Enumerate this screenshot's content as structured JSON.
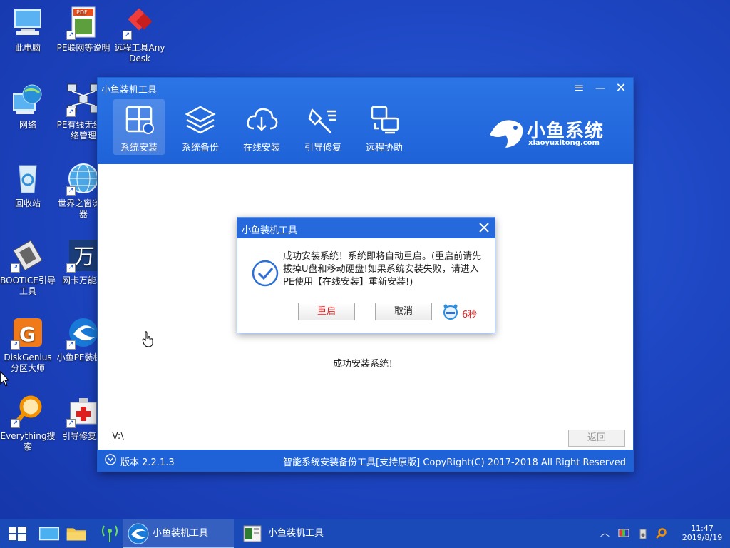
{
  "desktop": {
    "icons": [
      {
        "label": "此电脑"
      },
      {
        "label": "PE联网等说明"
      },
      {
        "label": "远程工具AnyDesk"
      },
      {
        "label": "网络"
      },
      {
        "label": "PE有线无线网络管理"
      },
      {
        "label": "回收站"
      },
      {
        "label": "世界之窗浏览器"
      },
      {
        "label": "BOOTICE引导工具"
      },
      {
        "label": "网卡万能驱"
      },
      {
        "label": "DiskGenius分区大师"
      },
      {
        "label": "小鱼PE装机具"
      },
      {
        "label": "Everything搜索"
      },
      {
        "label": "引导修复工"
      }
    ]
  },
  "window": {
    "title": "小鱼装机工具",
    "controls": {
      "menu": "≡",
      "minimize": "—",
      "close": "✕"
    },
    "toolbar": [
      {
        "label": "系统安装",
        "icon": "windows-install-icon",
        "active": true
      },
      {
        "label": "系统备份",
        "icon": "layers-backup-icon",
        "active": false
      },
      {
        "label": "在线安装",
        "icon": "cloud-download-icon",
        "active": false
      },
      {
        "label": "引导修复",
        "icon": "tools-repair-icon",
        "active": false
      },
      {
        "label": "远程协助",
        "icon": "remote-assist-icon",
        "active": false
      }
    ],
    "brand": {
      "name": "小鱼系统",
      "url": "xiaoyuxitong.com"
    },
    "status_message": "成功安装系统！",
    "path": "V:\\",
    "back_button": "返回",
    "footer": {
      "version": "版本 2.2.1.3",
      "copyright": "智能系统安装备份工具[支持原版]  CopyRight(C) 2017-2018 All Right Reserved"
    }
  },
  "dialog": {
    "title": "小鱼装机工具",
    "message": "成功安装系统！系统即将自动重启。(重启前请先拔掉U盘和移动硬盘!如果系统安装失败，请进入PE使用【在线安装】重新安装!)",
    "restart_button": "重启",
    "cancel_button": "取消",
    "countdown": "6秒"
  },
  "taskbar": {
    "tasks": [
      {
        "label": "小鱼装机工具"
      },
      {
        "label": "小鱼装机工具"
      }
    ],
    "clock": {
      "time": "11:47",
      "date": "2019/8/19"
    }
  },
  "colors": {
    "accent": "#1f62d8",
    "danger": "#e02020",
    "desktop": "#1e47c4"
  }
}
